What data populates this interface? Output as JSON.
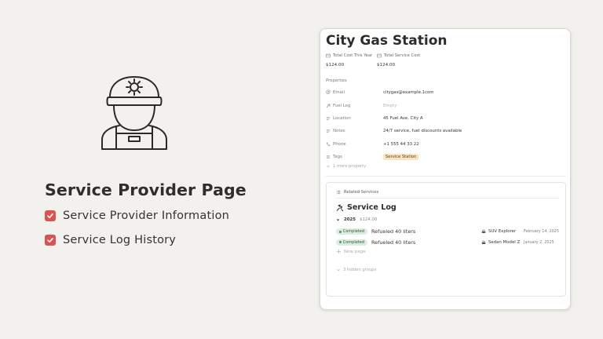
{
  "promo": {
    "headline": "Service Provider Page",
    "features": [
      "Service Provider Information",
      "Service Log History"
    ],
    "accent": "#d9534f"
  },
  "card": {
    "title": "City Gas Station",
    "stats": [
      {
        "label": "Total Cost This Year",
        "value": "$124.00"
      },
      {
        "label": "Total Service Cost",
        "value": "$124.00"
      }
    ],
    "properties_label": "Properties",
    "properties": [
      {
        "name": "Email",
        "icon": "at-icon",
        "value": "citygas@example.1com"
      },
      {
        "name": "Fuel Log",
        "icon": "arrow-up-right-icon",
        "value": "Empty"
      },
      {
        "name": "Location",
        "icon": "text-icon",
        "value": "45 Fuel Ave, City A"
      },
      {
        "name": "Notes",
        "icon": "text-icon",
        "value": "24/7 service, fuel discounts available"
      },
      {
        "name": "Phone",
        "icon": "phone-icon",
        "value": "+1 555 44 33 22"
      },
      {
        "name": "Tags",
        "icon": "list-icon",
        "value": "Service Station"
      }
    ],
    "more_property": "1 more property",
    "related": {
      "header": "Related Services",
      "title": "Service Log",
      "group": {
        "name": "2025",
        "sum": "$124.00"
      },
      "entries": [
        {
          "status": "Completed",
          "title": "Refueled 40 liters",
          "vehicle": "SUV Explorer",
          "date": "February 14, 2025"
        },
        {
          "status": "Completed",
          "title": "Refueled 40 liters",
          "vehicle": "Sedan Model Z",
          "date": "January 2, 2025"
        }
      ],
      "new_page": "New page",
      "hidden_groups": "3 hidden groups"
    },
    "status_color": "#dbeddb",
    "tag_color": "#fbe4c2"
  }
}
